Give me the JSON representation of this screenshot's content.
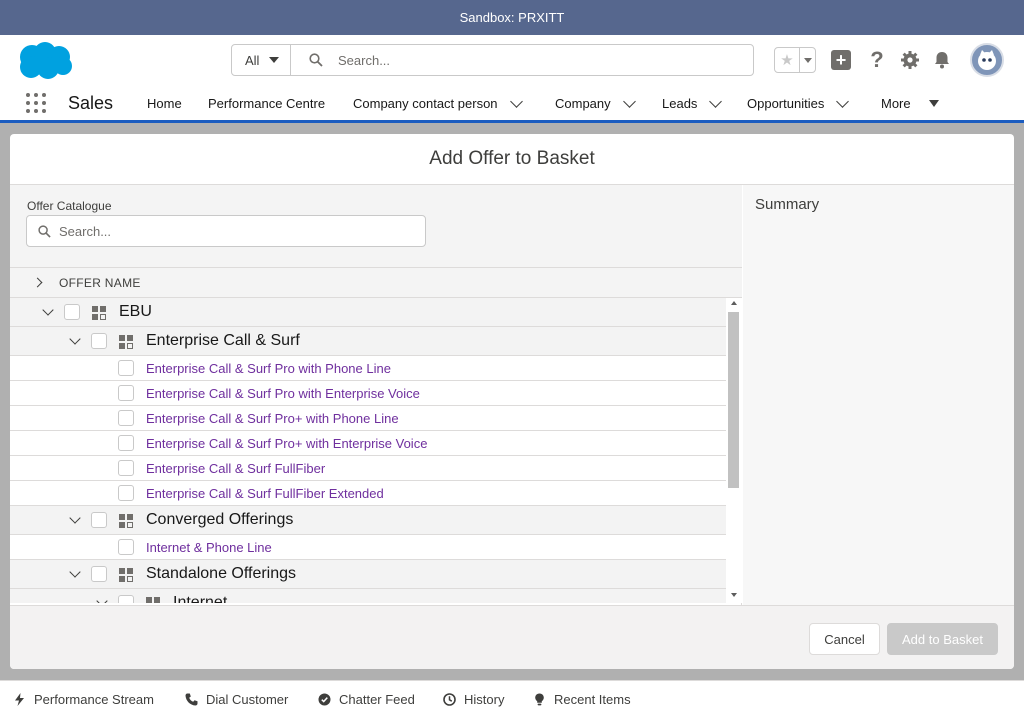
{
  "sandbox": {
    "label": "Sandbox: PRXITT"
  },
  "header": {
    "search_scope": "All",
    "search_placeholder": "Search..."
  },
  "nav": {
    "app_name": "Sales",
    "items": [
      {
        "label": "Home"
      },
      {
        "label": "Performance Centre"
      },
      {
        "label": "Company contact person"
      },
      {
        "label": "Company"
      },
      {
        "label": "Leads"
      },
      {
        "label": "Opportunities"
      },
      {
        "label": "More"
      }
    ]
  },
  "modal": {
    "title": "Add Offer to Basket",
    "catalogue_label": "Offer Catalogue",
    "catalogue_placeholder": "Search...",
    "column_header": "OFFER NAME",
    "summary_title": "Summary",
    "tree": [
      {
        "type": "group",
        "label": "EBU"
      },
      {
        "type": "group",
        "label": "Enterprise Call & Surf"
      },
      {
        "type": "leaf",
        "label": "Enterprise Call & Surf Pro with Phone Line"
      },
      {
        "type": "leaf",
        "label": "Enterprise Call & Surf Pro with Enterprise Voice"
      },
      {
        "type": "leaf",
        "label": "Enterprise Call & Surf Pro+ with Phone Line"
      },
      {
        "type": "leaf",
        "label": "Enterprise Call & Surf Pro+ with Enterprise Voice"
      },
      {
        "type": "leaf",
        "label": "Enterprise Call & Surf FullFiber"
      },
      {
        "type": "leaf",
        "label": "Enterprise Call & Surf FullFiber Extended"
      },
      {
        "type": "group",
        "label": "Converged Offerings"
      },
      {
        "type": "leaf",
        "label": "Internet & Phone Line"
      },
      {
        "type": "group",
        "label": "Standalone Offerings"
      },
      {
        "type": "group",
        "label": "Internet"
      }
    ],
    "cancel_label": "Cancel",
    "add_label": "Add to Basket"
  },
  "utility": {
    "items": [
      {
        "label": "Performance Stream"
      },
      {
        "label": "Dial Customer"
      },
      {
        "label": "Chatter Feed"
      },
      {
        "label": "History"
      },
      {
        "label": "Recent Items"
      }
    ]
  },
  "colors": {
    "sandbox_bar": "#56678e",
    "brand_blue": "#00a1e0",
    "nav_underline": "#1b5cc0",
    "offer_link": "#6f2f9e",
    "disabled_button": "#c9c9c9"
  }
}
